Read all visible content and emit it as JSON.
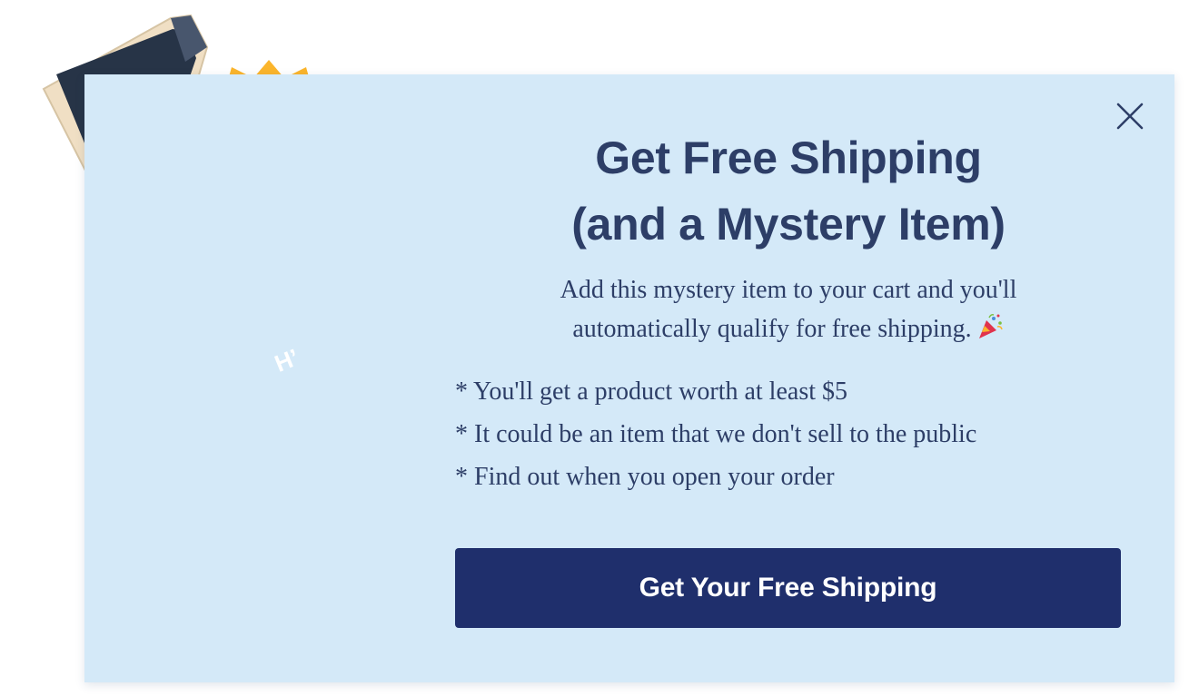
{
  "popup": {
    "title_line1": "Get Free Shipping",
    "title_line2": "(and a Mystery Item)",
    "subtitle_line1": "Add this mystery item to your cart and you'll",
    "subtitle_line2": "automatically qualify for free shipping.",
    "bullets": [
      "* You'll get a product worth at least $5",
      "* It could be an item that we don't sell to the public",
      "* Find out when you open your order"
    ],
    "cta_label": "Get Your Free Shipping",
    "box_logo": "H’"
  },
  "icons": {
    "close": "close-icon",
    "party": "party-popper-icon",
    "illustration": "mystery-box-icon",
    "question_badge": "question-mark-badge-icon"
  },
  "colors": {
    "modal_background": "#d4e9f8",
    "text": "#2d3e67",
    "button": "#1f2f6c",
    "button_text": "#ffffff",
    "badge": "#fbb52c",
    "box_inner": "#273447",
    "box_outer": "#f0dfc4"
  }
}
